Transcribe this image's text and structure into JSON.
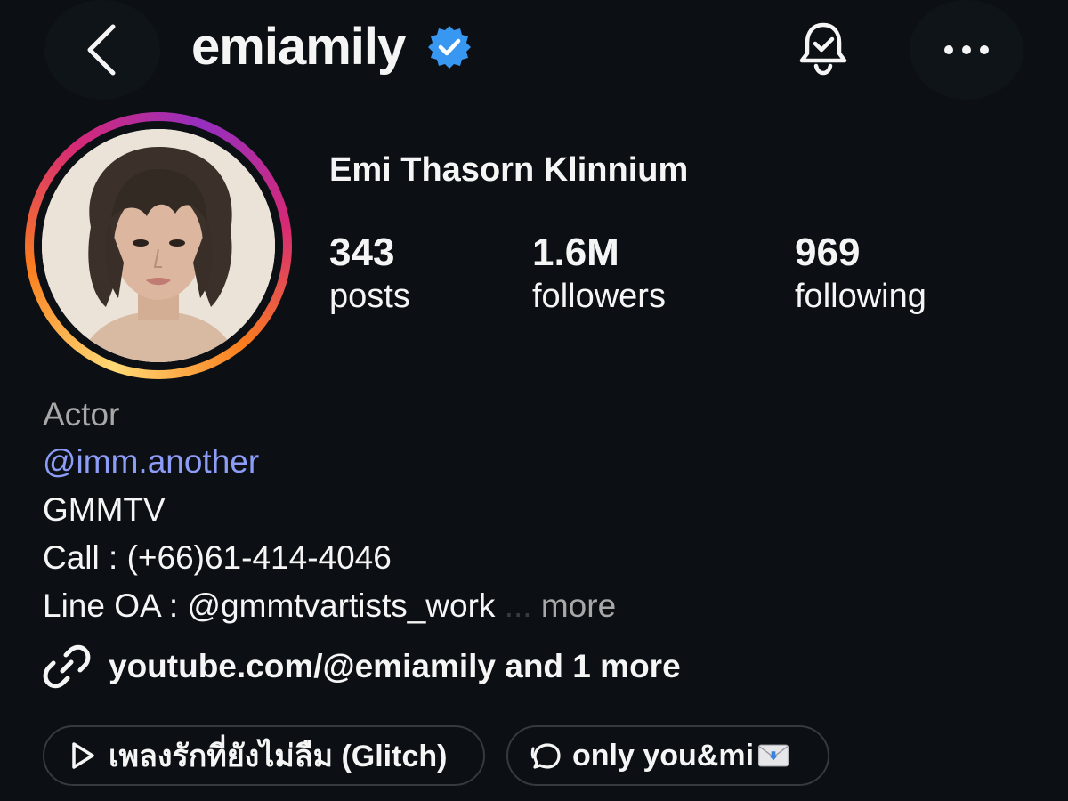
{
  "header": {
    "username": "emiamily",
    "verified": true,
    "back_icon": "chevron-left-icon",
    "bell_icon": "bell-check-icon",
    "more_icon": "more-dots-icon"
  },
  "profile": {
    "display_name": "Emi Thasorn Klinnium",
    "stats": {
      "posts": {
        "value": "343",
        "label": "posts"
      },
      "followers": {
        "value": "1.6M",
        "label": "followers"
      },
      "following": {
        "value": "969",
        "label": "following"
      }
    },
    "story_ring_colors": [
      "#feda75",
      "#fa7e1e",
      "#d62976",
      "#962fbf"
    ]
  },
  "bio": {
    "category": "Actor",
    "mention": "@imm.another",
    "line1": "GMMTV",
    "line2": "Call : (+66)61-414-4046",
    "line3": "Line OA : @gmmtvartists_work",
    "ellipsis": "...",
    "more_label": "more"
  },
  "link": {
    "icon": "link-icon",
    "text": "youtube.com/@emiamily and 1 more"
  },
  "chips": {
    "music": {
      "icon": "play-icon",
      "label": "เพลงรักที่ยังไม่ลืม (Glitch)"
    },
    "threads": {
      "icon": "threads-icon",
      "label": "only you&mi",
      "emoji": "incoming-envelope"
    }
  },
  "colors": {
    "background": "#0c1014",
    "mention_blue": "#8c9cf7",
    "muted": "#a8a8a8",
    "verified_blue": "#3897f0"
  }
}
